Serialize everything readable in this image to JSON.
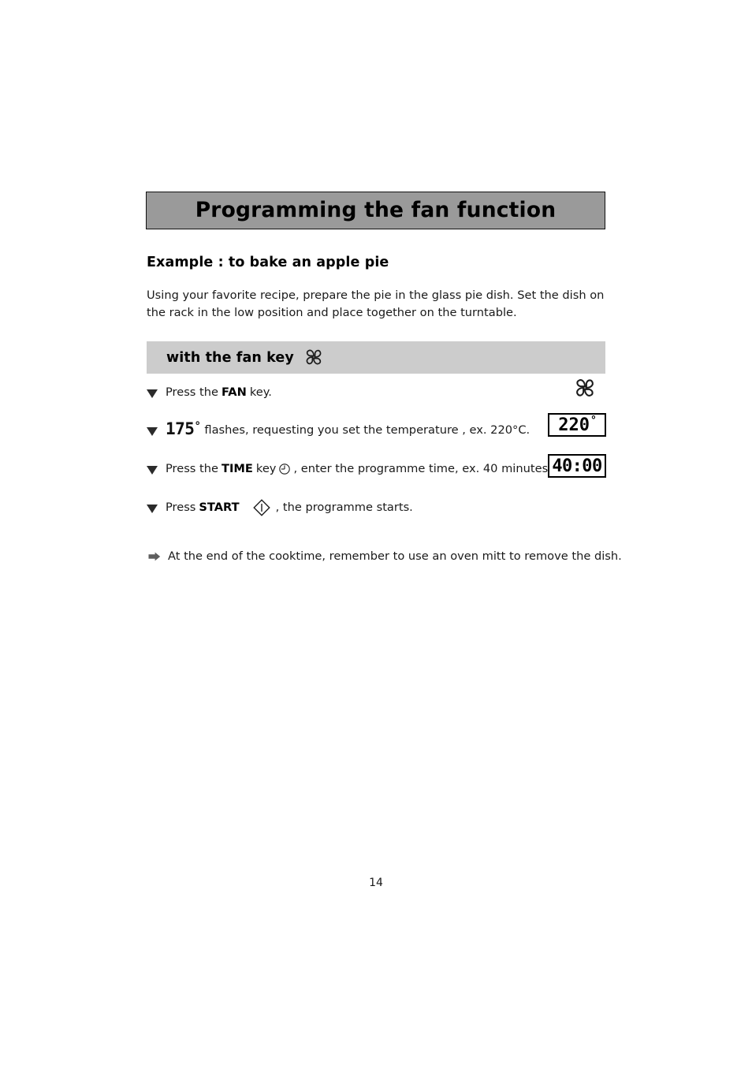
{
  "header": {
    "title": "Programming the fan function"
  },
  "example": {
    "heading": "Example : to bake an apple pie",
    "intro": "Using your favorite recipe, prepare the pie in the glass pie dish. Set the dish on the rack in the low position and place together on the turntable."
  },
  "band": {
    "label": "with the fan key",
    "icon": "fan-icon"
  },
  "steps": [
    {
      "bullet": "triangle-down-bullet",
      "text_before": "Press the",
      "bold": "FAN",
      "text_after": "key.",
      "display": "fan-icon"
    },
    {
      "bullet": "triangle-down-bullet",
      "lcd_value": "175",
      "lcd_degree": "°",
      "text_after": "flashes, requesting you set the temperature , ex. 220°C.",
      "display_value": "220",
      "display_degree": "°"
    },
    {
      "bullet": "triangle-down-bullet",
      "text_before": "Press the",
      "bold": "TIME",
      "text_mid": "key",
      "icon": "clock-icon",
      "text_after": ", enter the programme time, ex. 40 minutes.",
      "display_value": "40:00"
    },
    {
      "bullet": "triangle-down-bullet",
      "text_before": "Press",
      "bold": "START",
      "icon": "start-diamond-icon",
      "text_after": ", the programme starts."
    }
  ],
  "note": {
    "bullet": "arrow-right-bullet",
    "text": "At the end of the cooktime, remember to use an oven mitt to remove the dish."
  },
  "footer": {
    "page_number": "14"
  },
  "colors": {
    "title_bar_bg": "#9a9a9a",
    "band_bg": "#cccccc",
    "text": "#1a1a1a",
    "border": "#000000"
  }
}
